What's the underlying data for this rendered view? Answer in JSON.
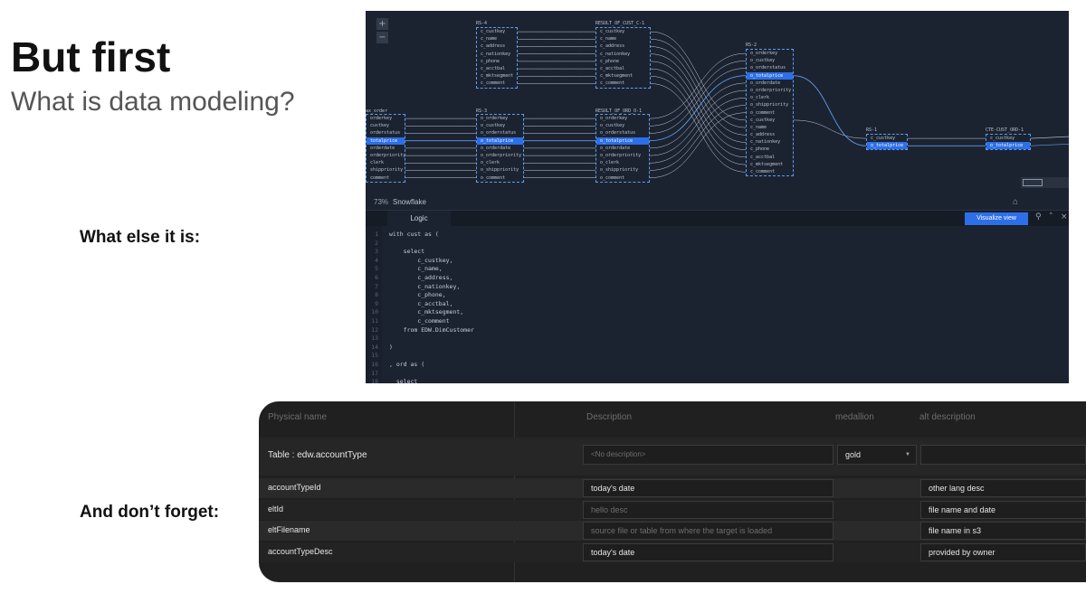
{
  "slide": {
    "title": "But first",
    "subtitle": "What is data modeling?",
    "label_else": "What else it is:",
    "label_forget": "And don’t forget:"
  },
  "lineage": {
    "zoom_in": "+",
    "zoom_out": "−",
    "zoom_level": "73%",
    "brand": "Snowflake",
    "tab_logic": "Logic",
    "visualize_label": "Visualize view",
    "nodes": [
      {
        "title": "RS-4",
        "rows": [
          "c_custkey",
          "c_name",
          "c_address",
          "c_nationkey",
          "c_phone",
          "c_acctbal",
          "c_mktsegment",
          "c_comment"
        ],
        "highlight": -1
      },
      {
        "title": "RESULT_OF_CUST_C-1",
        "rows": [
          "c_custkey",
          "c_name",
          "c_address",
          "c_nationkey",
          "c_phone",
          "c_acctbal",
          "c_mktsegment",
          "c_comment"
        ],
        "highlight": -1
      },
      {
        "title": "ax_order",
        "rows": [
          "orderkey",
          "custkey",
          "orderstatus",
          "totalprice",
          "orderdate",
          "orderpriority",
          "clerk",
          "shippriority",
          "comment"
        ],
        "highlight": 3
      },
      {
        "title": "RS-3",
        "rows": [
          "o_orderkey",
          "o_custkey",
          "o_orderstatus",
          "o_totalprice",
          "o_orderdate",
          "o_orderpriority",
          "o_clerk",
          "o_shippriority",
          "o_comment"
        ],
        "highlight": 3
      },
      {
        "title": "RESULT_OF_ORD_O-1",
        "rows": [
          "o_orderkey",
          "o_custkey",
          "o_orderstatus",
          "o_totalprice",
          "o_orderdate",
          "o_orderpriority",
          "o_clerk",
          "o_shippriority",
          "o_comment"
        ],
        "highlight": 3
      },
      {
        "title": "RS-2",
        "rows": [
          "o_orderkey",
          "o_custkey",
          "o_orderstatus",
          "o_totalprice",
          "o_orderdate",
          "o_orderpriority",
          "o_clerk",
          "o_shippriority",
          "o_comment",
          "c_custkey",
          "c_name",
          "c_address",
          "c_nationkey",
          "c_phone",
          "c_acctbal",
          "c_mktsegment",
          "c_comment"
        ],
        "highlight": 3
      },
      {
        "title": "RS-1",
        "rows": [
          "c_custkey",
          "o_totalprice"
        ],
        "highlight": 1
      },
      {
        "title": "CTE-CUST_ORD-1",
        "rows": [
          "c_custkey",
          "o_totalprice"
        ],
        "highlight": 1
      }
    ],
    "code_lines": [
      {
        "n": "1",
        "t": "with cust as ("
      },
      {
        "n": "2",
        "t": ""
      },
      {
        "n": "3",
        "t": "    select"
      },
      {
        "n": "4",
        "t": "        c_custkey,"
      },
      {
        "n": "5",
        "t": "        c_name,"
      },
      {
        "n": "6",
        "t": "        c_address,"
      },
      {
        "n": "7",
        "t": "        c_nationkey,"
      },
      {
        "n": "8",
        "t": "        c_phone,"
      },
      {
        "n": "9",
        "t": "        c_acctbal,"
      },
      {
        "n": "10",
        "t": "        c_mktsegment,"
      },
      {
        "n": "11",
        "t": "        c_comment"
      },
      {
        "n": "12",
        "t": "    from EDW.DimCustomer"
      },
      {
        "n": "13",
        "t": ""
      },
      {
        "n": "14",
        "t": ")"
      },
      {
        "n": "15",
        "t": ""
      },
      {
        "n": "16",
        "t": ", ord as ("
      },
      {
        "n": "17",
        "t": ""
      },
      {
        "n": "18",
        "t": "  select"
      }
    ]
  },
  "meta": {
    "headers": {
      "physical_name": "Physical name",
      "description": "Description",
      "medallion": "medallion",
      "alt_description": "alt description"
    },
    "table_row": {
      "name": "Table : edw.accountType",
      "description_placeholder": "<No description>",
      "medallion": "gold",
      "alt": ""
    },
    "rows": [
      {
        "name": "accountTypeId",
        "description": "today's date",
        "desc_placeholder": false,
        "alt": "other lang desc"
      },
      {
        "name": "eltId",
        "description": "hello desc",
        "desc_placeholder": true,
        "alt": "file name and date"
      },
      {
        "name": "eltFilename",
        "description": "source file or table from where the target is loaded",
        "desc_placeholder": true,
        "alt": "file name in s3"
      },
      {
        "name": "accountTypeDesc",
        "description": "today's date",
        "desc_placeholder": false,
        "alt": "provided by owner"
      }
    ]
  }
}
